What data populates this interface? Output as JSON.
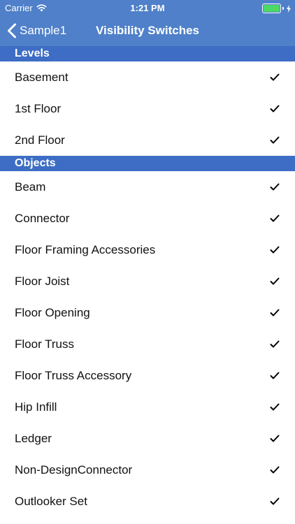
{
  "status_bar": {
    "carrier": "Carrier",
    "time": "1:21 PM",
    "battery_level": 1.0,
    "battery_color": "#4cd964",
    "wifi_icon": "wifi-icon",
    "charging_icon": "charging-bolt-icon"
  },
  "nav": {
    "back_label": "Sample1",
    "title": "Visibility Switches",
    "color": "#4f80c9"
  },
  "sections": [
    {
      "title": "Levels",
      "items": [
        {
          "label": "Basement",
          "checked": true
        },
        {
          "label": "1st Floor",
          "checked": true
        },
        {
          "label": "2nd Floor",
          "checked": true
        }
      ]
    },
    {
      "title": "Objects",
      "items": [
        {
          "label": "Beam",
          "checked": true
        },
        {
          "label": "Connector",
          "checked": true
        },
        {
          "label": "Floor Framing Accessories",
          "checked": true
        },
        {
          "label": "Floor Joist",
          "checked": true
        },
        {
          "label": "Floor Opening",
          "checked": true
        },
        {
          "label": "Floor Truss",
          "checked": true
        },
        {
          "label": "Floor Truss Accessory",
          "checked": true
        },
        {
          "label": "Hip Infill",
          "checked": true
        },
        {
          "label": "Ledger",
          "checked": true
        },
        {
          "label": "Non-DesignConnector",
          "checked": true
        },
        {
          "label": "Outlooker Set",
          "checked": true
        }
      ]
    }
  ],
  "colors": {
    "section_header": "#3d6dc4",
    "text": "#111111",
    "checkmark": "#000000"
  }
}
